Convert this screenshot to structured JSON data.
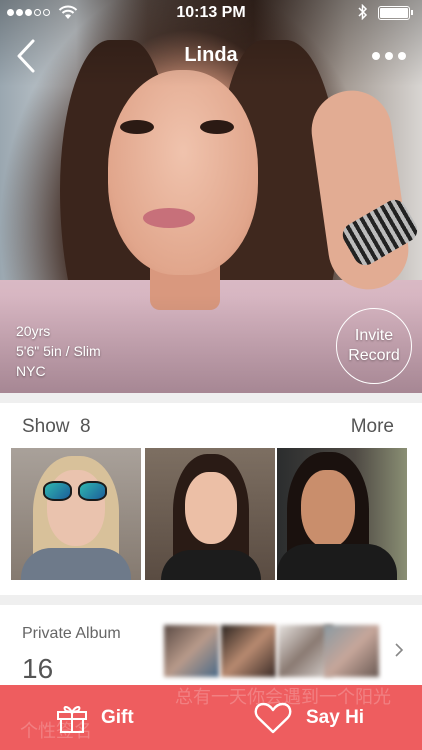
{
  "status_bar": {
    "time": "10:13 PM",
    "signal_dots_filled": 3,
    "signal_dots_total": 5,
    "bluetooth_icon": "bluetooth-icon",
    "battery_level": 0.9
  },
  "nav": {
    "title": "Linda",
    "back_icon": "chevron-left-icon",
    "more_icon": "more-dots-icon"
  },
  "profile": {
    "age": "20yrs",
    "body": "5'6\" 5in  /  Slim",
    "location": "NYC"
  },
  "invite_record": {
    "line1": "Invite",
    "line2": "Record"
  },
  "show": {
    "title": "Show",
    "count": "8",
    "more_label": "More"
  },
  "private_album": {
    "title": "Private Album",
    "count": "16",
    "chevron_icon": "chevron-right-icon"
  },
  "bottom_bar": {
    "gift_label": "Gift",
    "say_hi_label": "Say Hi",
    "gift_icon": "gift-icon",
    "heart_icon": "heart-icon",
    "background_text_1": "个性签名",
    "background_text_2": "总有一天你会遇到一个阳光"
  },
  "colors": {
    "accent": "#ee5d5f",
    "divider": "#efefef",
    "text_muted": "#555555"
  }
}
